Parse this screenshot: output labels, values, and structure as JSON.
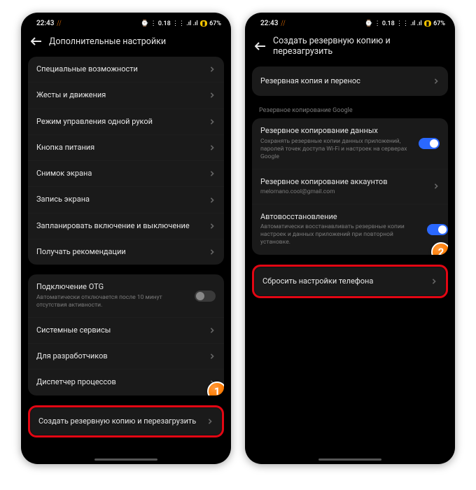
{
  "status": {
    "time": "22:43",
    "icons_right": "⌚ ⋮ 0.18 ⋮⋮ .ıl .ıl",
    "battery_label": "67%"
  },
  "callouts": {
    "one": "1",
    "two": "2"
  },
  "left": {
    "title": "Дополнительные настройки",
    "group1": [
      {
        "label": "Специальные возможности"
      },
      {
        "label": "Жесты и движения"
      },
      {
        "label": "Режим управления одной рукой"
      },
      {
        "label": "Кнопка питания"
      },
      {
        "label": "Снимок экрана"
      },
      {
        "label": "Запись экрана"
      },
      {
        "label": "Запланировать включение и выключение"
      },
      {
        "label": "Получать рекомендации"
      }
    ],
    "group2_otg": {
      "label": "Подключение OTG",
      "sub": "Автоматически отключается после 10 минут отсутствия активности."
    },
    "group2_rest": [
      {
        "label": "Системные сервисы"
      },
      {
        "label": "Для разработчиков"
      },
      {
        "label": "Диспетчер процессов"
      }
    ],
    "highlight_row": {
      "label": "Создать резервную копию и перезагрузить"
    }
  },
  "right": {
    "title": "Создать резервную копию и перезагрузить",
    "group1": [
      {
        "label": "Резервная копия и перенос"
      }
    ],
    "section_label": "Резервное копирование Google",
    "group2_backup": {
      "label": "Резервное копирование данных",
      "sub": "Сохранять резервные копии данных приложений, паролей точек доступа Wi-Fi и настроек на серверах Google"
    },
    "group2_accounts": {
      "label": "Резервное копирование аккаунтов",
      "sub": "melomano.cool@gmail.com"
    },
    "group2_autorestore": {
      "label": "Автовосстановление",
      "sub": "Автоматически восстанавливать резервные копии настроек и данных приложений при повторной установке."
    },
    "highlight_row": {
      "label": "Сбросить настройки телефона"
    }
  }
}
